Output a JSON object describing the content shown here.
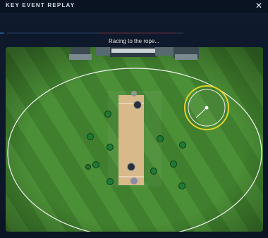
{
  "header": {
    "title": "KEY EVENT REPLAY",
    "close_label": "✕"
  },
  "replay": {
    "caption": "Racing to the rope..."
  },
  "colors": {
    "field_light": "#4b8f36",
    "field_dark": "#3f7f2d",
    "pitch": "#d8b989",
    "fielder": "#1f7a34",
    "highlight_ring": "#e6d12a",
    "panel_bg": "#0f1b2d"
  }
}
